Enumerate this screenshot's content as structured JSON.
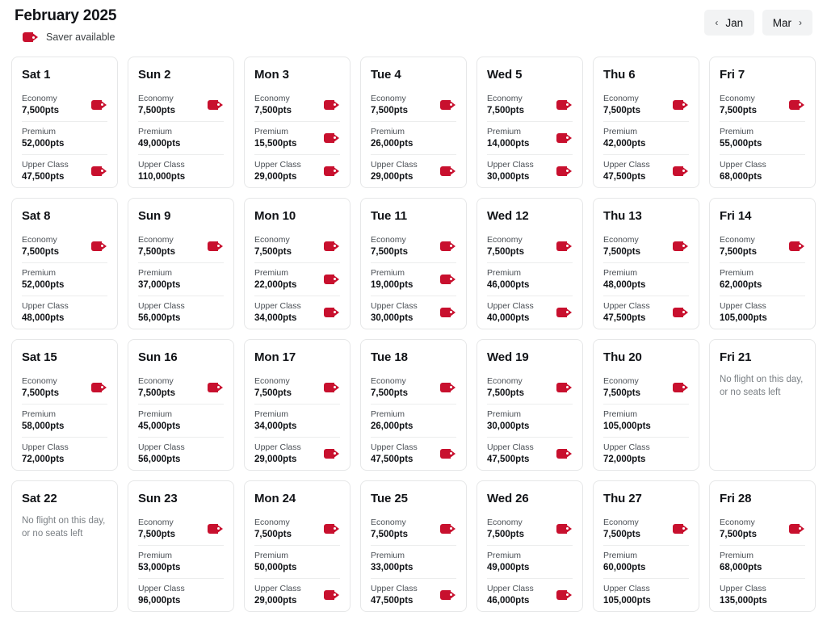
{
  "header": {
    "month_title": "February 2025",
    "legend": {
      "icon": "saver-tag-icon",
      "label": "Saver available"
    },
    "prev_button": {
      "chevron": "‹",
      "label": "Jan"
    },
    "next_button": {
      "label": "Mar",
      "chevron": "›"
    },
    "accent_color": "#c8102e"
  },
  "calendar": {
    "no_flight_message": "No flight on this day, or no seats left",
    "cabins": [
      "Economy",
      "Premium",
      "Upper Class"
    ],
    "days": [
      {
        "label": "Sat 1",
        "available": true,
        "fares": [
          {
            "cabin": "Economy",
            "points": "7,500pts",
            "saver": true
          },
          {
            "cabin": "Premium",
            "points": "52,000pts",
            "saver": false
          },
          {
            "cabin": "Upper Class",
            "points": "47,500pts",
            "saver": true
          }
        ]
      },
      {
        "label": "Sun 2",
        "available": true,
        "fares": [
          {
            "cabin": "Economy",
            "points": "7,500pts",
            "saver": true
          },
          {
            "cabin": "Premium",
            "points": "49,000pts",
            "saver": false
          },
          {
            "cabin": "Upper Class",
            "points": "110,000pts",
            "saver": false
          }
        ]
      },
      {
        "label": "Mon 3",
        "available": true,
        "fares": [
          {
            "cabin": "Economy",
            "points": "7,500pts",
            "saver": true
          },
          {
            "cabin": "Premium",
            "points": "15,500pts",
            "saver": true
          },
          {
            "cabin": "Upper Class",
            "points": "29,000pts",
            "saver": true
          }
        ]
      },
      {
        "label": "Tue 4",
        "available": true,
        "fares": [
          {
            "cabin": "Economy",
            "points": "7,500pts",
            "saver": true
          },
          {
            "cabin": "Premium",
            "points": "26,000pts",
            "saver": false
          },
          {
            "cabin": "Upper Class",
            "points": "29,000pts",
            "saver": true
          }
        ]
      },
      {
        "label": "Wed 5",
        "available": true,
        "fares": [
          {
            "cabin": "Economy",
            "points": "7,500pts",
            "saver": true
          },
          {
            "cabin": "Premium",
            "points": "14,000pts",
            "saver": true
          },
          {
            "cabin": "Upper Class",
            "points": "30,000pts",
            "saver": true
          }
        ]
      },
      {
        "label": "Thu 6",
        "available": true,
        "fares": [
          {
            "cabin": "Economy",
            "points": "7,500pts",
            "saver": true
          },
          {
            "cabin": "Premium",
            "points": "42,000pts",
            "saver": false
          },
          {
            "cabin": "Upper Class",
            "points": "47,500pts",
            "saver": true
          }
        ]
      },
      {
        "label": "Fri 7",
        "available": true,
        "fares": [
          {
            "cabin": "Economy",
            "points": "7,500pts",
            "saver": true
          },
          {
            "cabin": "Premium",
            "points": "55,000pts",
            "saver": false
          },
          {
            "cabin": "Upper Class",
            "points": "68,000pts",
            "saver": false
          }
        ]
      },
      {
        "label": "Sat 8",
        "available": true,
        "fares": [
          {
            "cabin": "Economy",
            "points": "7,500pts",
            "saver": true
          },
          {
            "cabin": "Premium",
            "points": "52,000pts",
            "saver": false
          },
          {
            "cabin": "Upper Class",
            "points": "48,000pts",
            "saver": false
          }
        ]
      },
      {
        "label": "Sun 9",
        "available": true,
        "fares": [
          {
            "cabin": "Economy",
            "points": "7,500pts",
            "saver": true
          },
          {
            "cabin": "Premium",
            "points": "37,000pts",
            "saver": false
          },
          {
            "cabin": "Upper Class",
            "points": "56,000pts",
            "saver": false
          }
        ]
      },
      {
        "label": "Mon 10",
        "available": true,
        "fares": [
          {
            "cabin": "Economy",
            "points": "7,500pts",
            "saver": true
          },
          {
            "cabin": "Premium",
            "points": "22,000pts",
            "saver": true
          },
          {
            "cabin": "Upper Class",
            "points": "34,000pts",
            "saver": true
          }
        ]
      },
      {
        "label": "Tue 11",
        "available": true,
        "fares": [
          {
            "cabin": "Economy",
            "points": "7,500pts",
            "saver": true
          },
          {
            "cabin": "Premium",
            "points": "19,000pts",
            "saver": true
          },
          {
            "cabin": "Upper Class",
            "points": "30,000pts",
            "saver": true
          }
        ]
      },
      {
        "label": "Wed 12",
        "available": true,
        "fares": [
          {
            "cabin": "Economy",
            "points": "7,500pts",
            "saver": true
          },
          {
            "cabin": "Premium",
            "points": "46,000pts",
            "saver": false
          },
          {
            "cabin": "Upper Class",
            "points": "40,000pts",
            "saver": true
          }
        ]
      },
      {
        "label": "Thu 13",
        "available": true,
        "fares": [
          {
            "cabin": "Economy",
            "points": "7,500pts",
            "saver": true
          },
          {
            "cabin": "Premium",
            "points": "48,000pts",
            "saver": false
          },
          {
            "cabin": "Upper Class",
            "points": "47,500pts",
            "saver": true
          }
        ]
      },
      {
        "label": "Fri 14",
        "available": true,
        "fares": [
          {
            "cabin": "Economy",
            "points": "7,500pts",
            "saver": true
          },
          {
            "cabin": "Premium",
            "points": "62,000pts",
            "saver": false
          },
          {
            "cabin": "Upper Class",
            "points": "105,000pts",
            "saver": false
          }
        ]
      },
      {
        "label": "Sat 15",
        "available": true,
        "fares": [
          {
            "cabin": "Economy",
            "points": "7,500pts",
            "saver": true
          },
          {
            "cabin": "Premium",
            "points": "58,000pts",
            "saver": false
          },
          {
            "cabin": "Upper Class",
            "points": "72,000pts",
            "saver": false
          }
        ]
      },
      {
        "label": "Sun 16",
        "available": true,
        "fares": [
          {
            "cabin": "Economy",
            "points": "7,500pts",
            "saver": true
          },
          {
            "cabin": "Premium",
            "points": "45,000pts",
            "saver": false
          },
          {
            "cabin": "Upper Class",
            "points": "56,000pts",
            "saver": false
          }
        ]
      },
      {
        "label": "Mon 17",
        "available": true,
        "fares": [
          {
            "cabin": "Economy",
            "points": "7,500pts",
            "saver": true
          },
          {
            "cabin": "Premium",
            "points": "34,000pts",
            "saver": false
          },
          {
            "cabin": "Upper Class",
            "points": "29,000pts",
            "saver": true
          }
        ]
      },
      {
        "label": "Tue 18",
        "available": true,
        "fares": [
          {
            "cabin": "Economy",
            "points": "7,500pts",
            "saver": true
          },
          {
            "cabin": "Premium",
            "points": "26,000pts",
            "saver": false
          },
          {
            "cabin": "Upper Class",
            "points": "47,500pts",
            "saver": true
          }
        ]
      },
      {
        "label": "Wed 19",
        "available": true,
        "fares": [
          {
            "cabin": "Economy",
            "points": "7,500pts",
            "saver": true
          },
          {
            "cabin": "Premium",
            "points": "30,000pts",
            "saver": false
          },
          {
            "cabin": "Upper Class",
            "points": "47,500pts",
            "saver": true
          }
        ]
      },
      {
        "label": "Thu 20",
        "available": true,
        "fares": [
          {
            "cabin": "Economy",
            "points": "7,500pts",
            "saver": true
          },
          {
            "cabin": "Premium",
            "points": "105,000pts",
            "saver": false
          },
          {
            "cabin": "Upper Class",
            "points": "72,000pts",
            "saver": false
          }
        ]
      },
      {
        "label": "Fri 21",
        "available": false,
        "fares": []
      },
      {
        "label": "Sat 22",
        "available": false,
        "fares": []
      },
      {
        "label": "Sun 23",
        "available": true,
        "fares": [
          {
            "cabin": "Economy",
            "points": "7,500pts",
            "saver": true
          },
          {
            "cabin": "Premium",
            "points": "53,000pts",
            "saver": false
          },
          {
            "cabin": "Upper Class",
            "points": "96,000pts",
            "saver": false
          }
        ]
      },
      {
        "label": "Mon 24",
        "available": true,
        "fares": [
          {
            "cabin": "Economy",
            "points": "7,500pts",
            "saver": true
          },
          {
            "cabin": "Premium",
            "points": "50,000pts",
            "saver": false
          },
          {
            "cabin": "Upper Class",
            "points": "29,000pts",
            "saver": true
          }
        ]
      },
      {
        "label": "Tue 25",
        "available": true,
        "fares": [
          {
            "cabin": "Economy",
            "points": "7,500pts",
            "saver": true
          },
          {
            "cabin": "Premium",
            "points": "33,000pts",
            "saver": false
          },
          {
            "cabin": "Upper Class",
            "points": "47,500pts",
            "saver": true
          }
        ]
      },
      {
        "label": "Wed 26",
        "available": true,
        "fares": [
          {
            "cabin": "Economy",
            "points": "7,500pts",
            "saver": true
          },
          {
            "cabin": "Premium",
            "points": "49,000pts",
            "saver": false
          },
          {
            "cabin": "Upper Class",
            "points": "46,000pts",
            "saver": true
          }
        ]
      },
      {
        "label": "Thu 27",
        "available": true,
        "fares": [
          {
            "cabin": "Economy",
            "points": "7,500pts",
            "saver": true
          },
          {
            "cabin": "Premium",
            "points": "60,000pts",
            "saver": false
          },
          {
            "cabin": "Upper Class",
            "points": "105,000pts",
            "saver": false
          }
        ]
      },
      {
        "label": "Fri 28",
        "available": true,
        "fares": [
          {
            "cabin": "Economy",
            "points": "7,500pts",
            "saver": true
          },
          {
            "cabin": "Premium",
            "points": "68,000pts",
            "saver": false
          },
          {
            "cabin": "Upper Class",
            "points": "135,000pts",
            "saver": false
          }
        ]
      }
    ]
  }
}
